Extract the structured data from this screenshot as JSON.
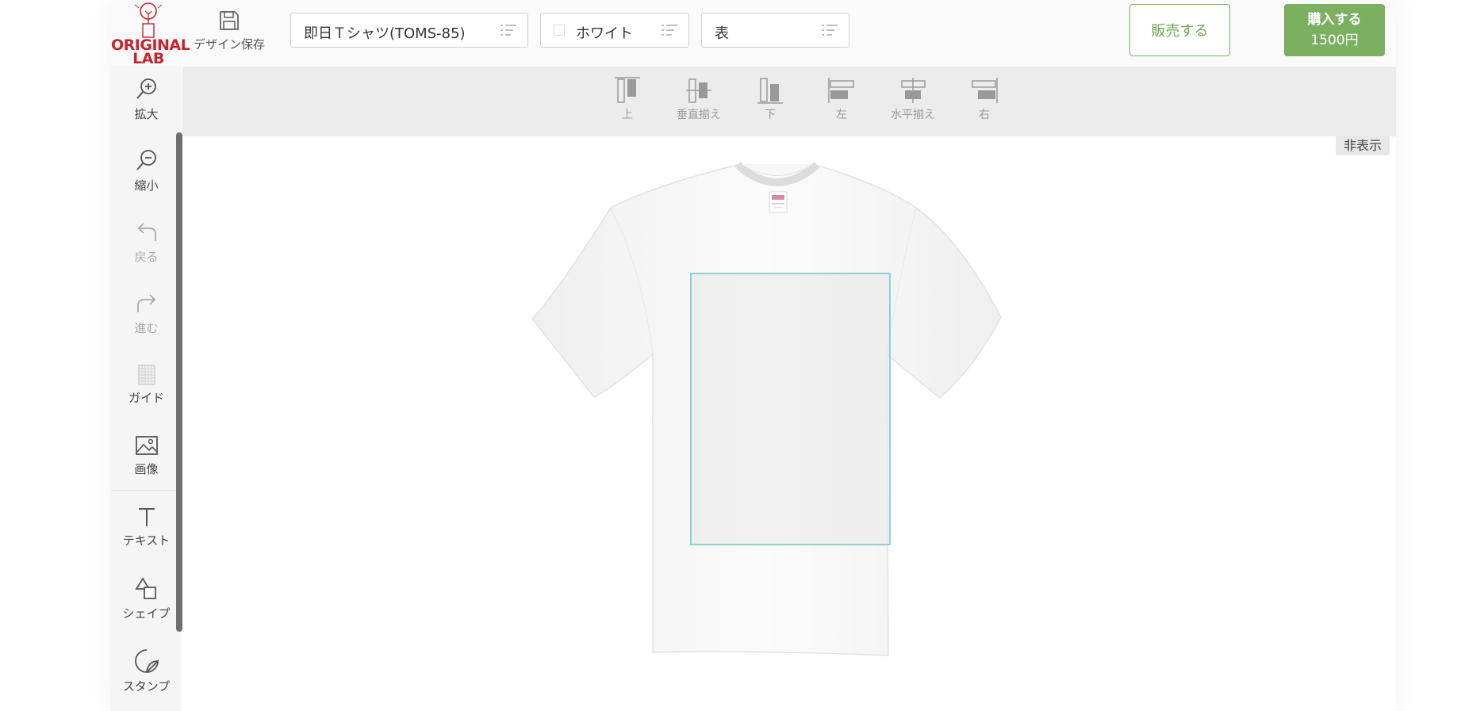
{
  "header": {
    "logo": {
      "line1": "ORIGINAL",
      "line2": "LAB"
    },
    "save_label": "デザイン保存",
    "product_select": "即日Ｔシャツ(TOMS-85)",
    "color_select": "ホワイト",
    "side_select": "表",
    "sell_label": "販売する",
    "buy_label": "購入する",
    "buy_price": "1500円"
  },
  "sidebar": {
    "tools": [
      {
        "label": "拡大",
        "icon": "zoom-in-icon"
      },
      {
        "label": "縮小",
        "icon": "zoom-out-icon"
      },
      {
        "label": "戻る",
        "icon": "undo-icon"
      },
      {
        "label": "進む",
        "icon": "redo-icon"
      },
      {
        "label": "ガイド",
        "icon": "grid-icon"
      },
      {
        "label": "画像",
        "icon": "image-icon"
      },
      {
        "label": "テキスト",
        "icon": "text-icon"
      },
      {
        "label": "シェイプ",
        "icon": "shape-icon"
      },
      {
        "label": "スタンプ",
        "icon": "stamp-icon"
      }
    ]
  },
  "alignbar": {
    "items": [
      {
        "label": "上",
        "icon": "align-top-icon"
      },
      {
        "label": "垂直揃え",
        "icon": "align-vertical-center-icon"
      },
      {
        "label": "下",
        "icon": "align-bottom-icon"
      },
      {
        "label": "左",
        "icon": "align-left-icon"
      },
      {
        "label": "水平揃え",
        "icon": "align-horizontal-center-icon"
      },
      {
        "label": "右",
        "icon": "align-right-icon"
      }
    ]
  },
  "canvas": {
    "hide_label": "非表示",
    "print_area_color": "#8fd0d0"
  },
  "colors": {
    "brand_red": "#c4262e",
    "accent_green": "#7ab060"
  }
}
